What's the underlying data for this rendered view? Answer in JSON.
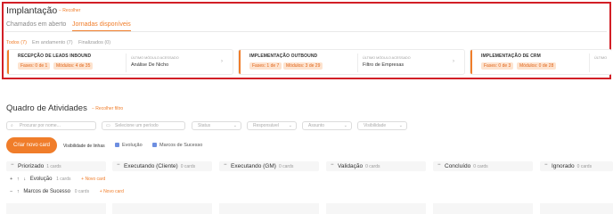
{
  "implantacao": {
    "title": "Implantação",
    "collapse_label": "− Recolher",
    "tabs": [
      {
        "label": "Chamados em aberto",
        "active": false
      },
      {
        "label": "Jornadas disponíveis",
        "active": true
      }
    ],
    "filters": [
      {
        "label": "Todos (7)",
        "active": true
      },
      {
        "label": "Em andamento (7)",
        "active": false
      },
      {
        "label": "Finalizados (0)",
        "active": false
      }
    ],
    "last_module_label": "ÚLTIMO MÓDULO ACESSADO",
    "cards": [
      {
        "name": "RECEPÇÃO DE LEADS INBOUND",
        "phases": "Fases: 0 de 1",
        "modules": "Módulos: 4 de 35",
        "last_module": "Análise De Nicho"
      },
      {
        "name": "IMPLEMENTAÇÃO OUTBOUND",
        "phases": "Fases: 1 de 7",
        "modules": "Módulos: 3 de 29",
        "last_module": "Filtro de Empresas"
      },
      {
        "name": "IMPLEMENTAÇÃO DE CRM",
        "phases": "Fases: 0 de 3",
        "modules": "Módulos: 0 de 28",
        "last_module": "ÚLTIMO"
      }
    ]
  },
  "board": {
    "title": "Quadro de Atividades",
    "collapse_filter_label": "− Recolher filtro",
    "filters": {
      "search_placeholder": "Procurar por nome...",
      "period_placeholder": "Selecione um período",
      "status": "Status",
      "responsible": "Responsável",
      "subject": "Assunto",
      "visibility": "Visibilidade"
    },
    "create_button": "Criar novo card",
    "lines_visibility_label": "Visibilidade de linhas",
    "line_toggles": [
      {
        "label": "Evolução",
        "checked": true
      },
      {
        "label": "Marcos de Sucesso",
        "checked": true
      }
    ],
    "columns": [
      {
        "name": "Priorizado",
        "count": "1 cards"
      },
      {
        "name": "Executando (Cliente)",
        "count": "0 cards"
      },
      {
        "name": "Executando (GM)",
        "count": "0 cards"
      },
      {
        "name": "Validação",
        "count": "0 cards"
      },
      {
        "name": "Concluído",
        "count": "0 cards"
      },
      {
        "name": "Ignorado",
        "count": "0 cards"
      }
    ],
    "rows": [
      {
        "name": "Evolução",
        "count": "1 cards",
        "add_label": "+ Novo card"
      },
      {
        "name": "Marcos de Sucesso",
        "count": "0 cards",
        "add_label": "+ Novo card"
      }
    ]
  },
  "colors": {
    "accent": "#f07d2a",
    "frame": "#d21f26",
    "badge_bg": "#fde3cf",
    "checkbox": "#6d8ee0"
  }
}
